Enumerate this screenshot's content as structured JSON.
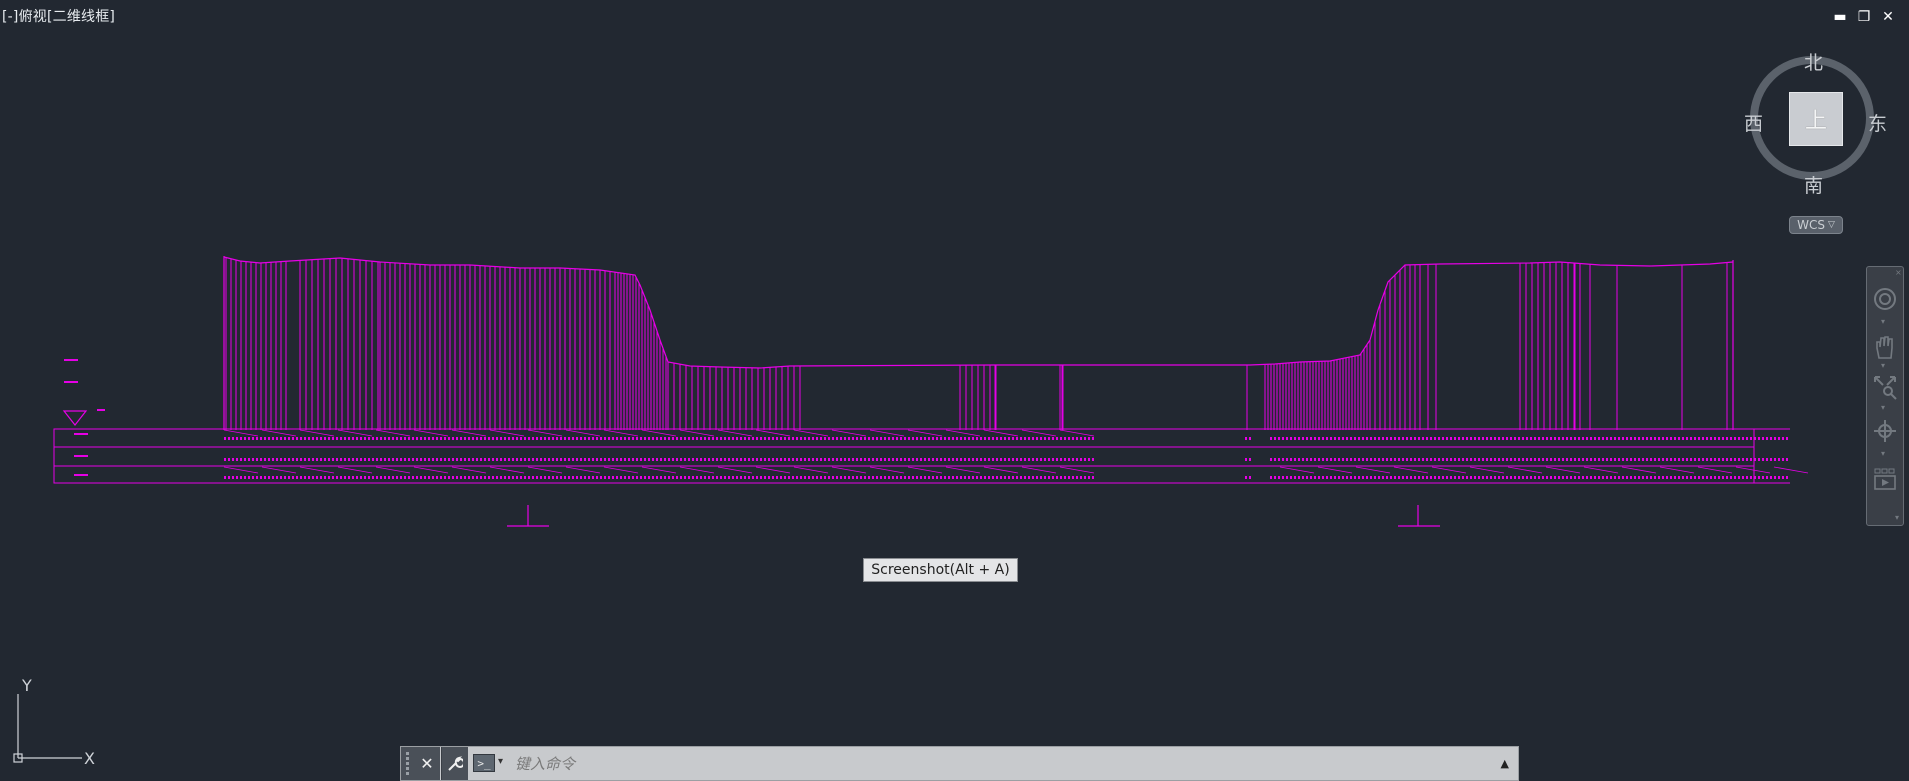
{
  "viewport": {
    "label": "[-]俯视[二维线框]"
  },
  "window_controls": {
    "minimize": "▬",
    "restore": "❐",
    "close": "✕"
  },
  "viewcube": {
    "north": "北",
    "south": "南",
    "west": "西",
    "east": "东",
    "face": "上",
    "coordinate_system": "WCS"
  },
  "tooltip": {
    "text": "Screenshot(Alt + A)"
  },
  "command_line": {
    "placeholder": "键入命令",
    "prompt_symbol": ">_"
  },
  "ucs_icon": {
    "x_label": "X",
    "y_label": "Y"
  },
  "colors": {
    "background": "#222831",
    "drawing_lines": "#e600e6",
    "ui_panel": "#c8cacd"
  }
}
